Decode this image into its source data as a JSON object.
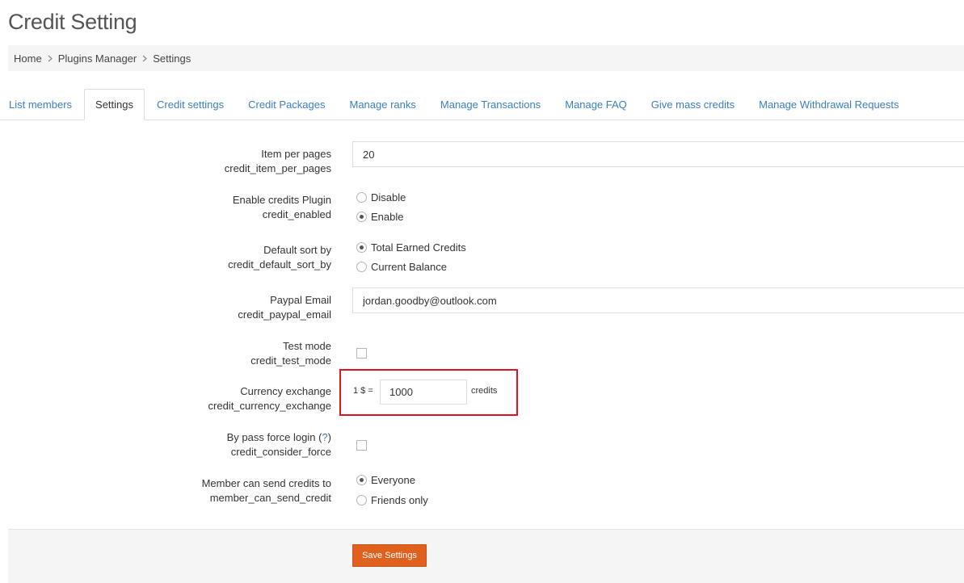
{
  "page": {
    "title": "Credit Setting"
  },
  "breadcrumb": [
    "Home",
    "Plugins Manager",
    "Settings"
  ],
  "tabs": [
    "List members",
    "Settings",
    "Credit settings",
    "Credit Packages",
    "Manage ranks",
    "Manage Transactions",
    "Manage FAQ",
    "Give mass credits",
    "Manage Withdrawal Requests"
  ],
  "active_tab": "Settings",
  "form": {
    "item_per_pages": {
      "label": "Item per pages",
      "key": "credit_item_per_pages",
      "value": "20"
    },
    "enabled": {
      "label": "Enable credits Plugin",
      "key": "credit_enabled",
      "options": [
        "Disable",
        "Enable"
      ],
      "selected": "Enable"
    },
    "default_sort": {
      "label": "Default sort by",
      "key": "credit_default_sort_by",
      "options": [
        "Total Earned Credits",
        "Current Balance"
      ],
      "selected": "Total Earned Credits"
    },
    "paypal_email": {
      "label": "Paypal Email",
      "key": "credit_paypal_email",
      "value": "jordan.goodby@outlook.com"
    },
    "test_mode": {
      "label": "Test mode",
      "key": "credit_test_mode",
      "checked": false
    },
    "currency_exchange": {
      "label": "Currency exchange",
      "key": "credit_currency_exchange",
      "prefix": "1 $ =",
      "value": "1000",
      "suffix": "credits"
    },
    "bypass_force_login": {
      "label": "By pass force login (",
      "help": "?",
      "label_end": ")",
      "key": "credit_consider_force",
      "checked": false
    },
    "member_send": {
      "label": "Member can send credits to",
      "key": "member_can_send_credit",
      "options": [
        "Everyone",
        "Friends only"
      ],
      "selected": "Everyone"
    }
  },
  "actions": {
    "save_label": "Save Settings"
  },
  "colors": {
    "link": "#3a7fc1",
    "save_button": "#e0601e",
    "highlight": "#e0141e"
  }
}
